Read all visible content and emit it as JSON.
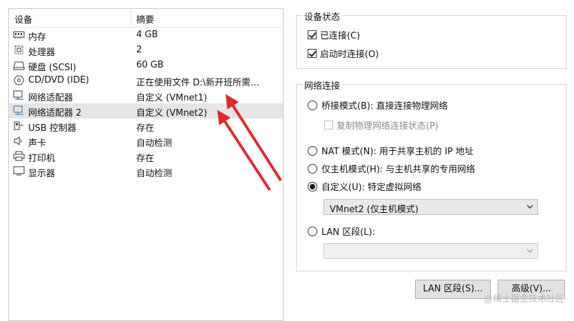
{
  "device_list": {
    "col_device": "设备",
    "col_summary": "摘要",
    "rows": [
      {
        "icon": "memory-icon",
        "name": "内存",
        "summary": "4 GB"
      },
      {
        "icon": "processor-icon",
        "name": "处理器",
        "summary": "2"
      },
      {
        "icon": "hard-disk-icon",
        "name": "硬盘 (SCSI)",
        "summary": "60 GB"
      },
      {
        "icon": "cd-dvd-icon",
        "name": "CD/DVD (IDE)",
        "summary": "正在使用文件 D:\\新开班所需…"
      },
      {
        "icon": "network-adapter-icon",
        "name": "网络适配器",
        "summary": "自定义 (VMnet1)"
      },
      {
        "icon": "network-adapter-icon",
        "name": "网络适配器 2",
        "summary": "自定义 (VMnet2)"
      },
      {
        "icon": "usb-controller-icon",
        "name": "USB 控制器",
        "summary": "存在"
      },
      {
        "icon": "sound-card-icon",
        "name": "声卡",
        "summary": "自动检测"
      },
      {
        "icon": "printer-icon",
        "name": "打印机",
        "summary": "存在"
      },
      {
        "icon": "display-icon",
        "name": "显示器",
        "summary": "自动检测"
      }
    ],
    "selected_index": 5
  },
  "device_status": {
    "title": "设备状态",
    "connected": {
      "label": "已连接(C)",
      "checked": true
    },
    "connect_on_power": {
      "label": "启动时连接(O)",
      "checked": true
    }
  },
  "network": {
    "title": "网络连接",
    "bridged": "桥接模式(B): 直接连接物理网络",
    "replicate": "复制物理网络连接状态(P)",
    "nat": "NAT 模式(N): 用于共享主机的 IP 地址",
    "host_only": "仅主机模式(H): 与主机共享的专用网络",
    "custom": "自定义(U): 特定虚拟网络",
    "custom_value": "VMnet2 (仅主机模式)",
    "lan_segment": "LAN 区段(L):",
    "lan_value": "",
    "selected": "custom"
  },
  "buttons": {
    "lan_segments": "LAN 区段(S)...",
    "advanced": "高级(V)..."
  },
  "watermark": "@稀土掘金技术社区",
  "colors": {
    "arrow": "#e02a2a",
    "selected_row": "#e5e5e5"
  }
}
